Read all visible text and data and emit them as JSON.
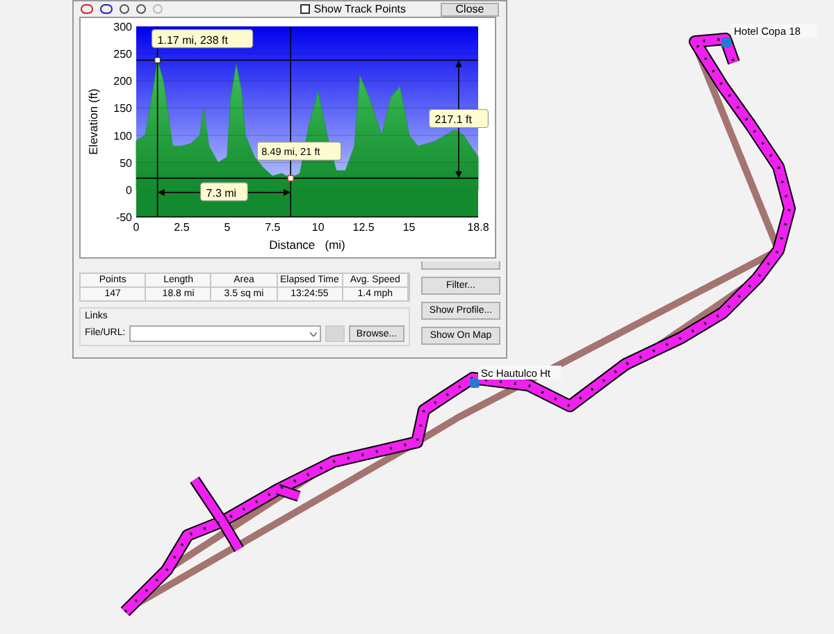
{
  "dialog": {
    "toolbar": {
      "show_track_points": {
        "label": "Show Track Points",
        "checked": false
      },
      "close_button": "Close"
    },
    "profile": {
      "chart_data": {
        "type": "area",
        "xlabel": "Distance   (mi)",
        "ylabel": "Elevation (ft)",
        "x": [
          0,
          0.5,
          1.0,
          1.17,
          1.5,
          2.0,
          2.5,
          3.0,
          3.5,
          3.7,
          4.0,
          4.5,
          5.0,
          5.2,
          5.5,
          5.8,
          6.0,
          6.5,
          7.0,
          7.5,
          8.0,
          8.49,
          9.0,
          9.5,
          10.0,
          10.5,
          11.0,
          11.5,
          12.0,
          12.3,
          12.8,
          13.5,
          14.0,
          14.5,
          15.0,
          15.5,
          16.0,
          16.5,
          17.0,
          17.5,
          18.0,
          18.8
        ],
        "grid": true,
        "series": [
          {
            "color": "#1f9a3a",
            "values": [
              90,
              100,
              200,
              238,
              200,
              80,
              80,
              85,
              100,
              150,
              80,
              50,
              60,
              170,
              230,
              180,
              100,
              60,
              40,
              25,
              30,
              21,
              30,
              120,
              180,
              100,
              35,
              35,
              80,
              210,
              170,
              100,
              170,
              190,
              100,
              80,
              85,
              90,
              100,
              110,
              100,
              60
            ]
          }
        ],
        "xlim": [
          0,
          18.8
        ],
        "ylim": [
          -50,
          300
        ],
        "xticks": [
          0,
          2.5,
          5,
          7.5,
          10,
          12.5,
          15,
          {
            "value": 18.8,
            "label": "18.8"
          }
        ],
        "yticks": [
          -50,
          0,
          50,
          100,
          150,
          200,
          250,
          300
        ],
        "annotations": [
          {
            "text": "1.17 mi, 238 ft",
            "x": 1.17,
            "y": 238
          },
          {
            "text": "8.49 mi, 21 ft",
            "x": 8.49,
            "y": 21
          },
          {
            "text": "217.1 ft"
          },
          {
            "text": "7.3 mi"
          }
        ]
      }
    },
    "stats": {
      "columns": [
        "Points",
        "Length",
        "Area",
        "Elapsed Time",
        "Avg. Speed"
      ],
      "values": [
        "147",
        "18.8 mi",
        "3.5 sq mi",
        "13:24:55",
        "1.4 mph"
      ]
    },
    "links": {
      "title": "Links",
      "file_label": "File/URL:",
      "browse_button": "Browse..."
    },
    "buttons": [
      "Filter...",
      "Show Profile...",
      "Show On Map"
    ]
  },
  "map": {
    "labels": [
      {
        "text": "Hotel Copa 18"
      },
      {
        "text": "Sc Hautulco Ht"
      }
    ]
  }
}
